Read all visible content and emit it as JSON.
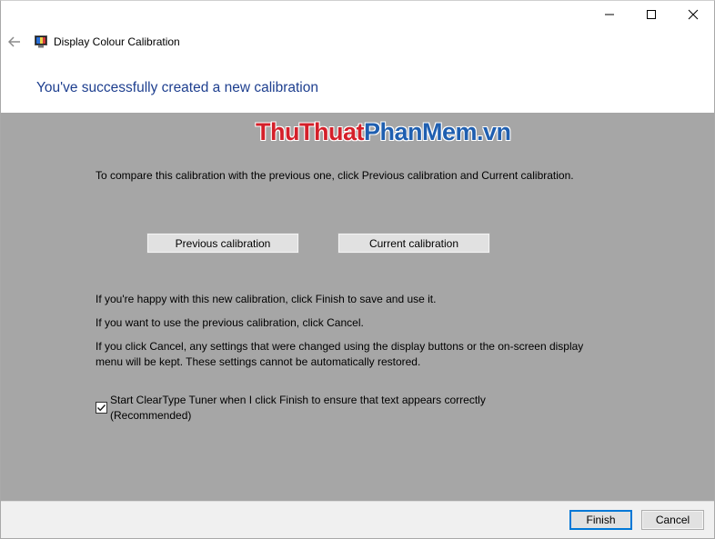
{
  "window": {
    "app_title": "Display Colour Calibration",
    "caption_buttons": {
      "minimize_icon": "minimize-icon",
      "maximize_icon": "maximize-icon",
      "close_icon": "close-icon"
    }
  },
  "header": {
    "back_icon": "back-arrow-icon",
    "app_icon": "display-calibration-icon",
    "page_title": "You've successfully created a new calibration"
  },
  "watermark": {
    "part1": "ThuThuat",
    "part2": "PhanMem",
    "part3": ".vn",
    "colors": {
      "red": "#d4202a",
      "blue": "#1f5fb0"
    }
  },
  "content": {
    "compare_text": "To compare this calibration with the previous one, click Previous calibration and Current calibration.",
    "previous_button": "Previous calibration",
    "current_button": "Current calibration",
    "finish_text": "If you're happy with this new calibration, click Finish to save and use it.",
    "cancel_text": "If you want to use the previous calibration, click Cancel.",
    "warning_text": "If you click Cancel, any settings that were changed using the display buttons or the on-screen display menu will be kept. These settings cannot be automatically restored.",
    "cleartype_checkbox": {
      "checked": true,
      "label": "Start ClearType Tuner when I click Finish to ensure that text appears correctly (Recommended)"
    },
    "background_color": "#a6a6a6"
  },
  "footer": {
    "finish_button": "Finish",
    "cancel_button": "Cancel"
  },
  "colors": {
    "title_blue": "#1e3f8f",
    "focus_blue": "#0078d7"
  }
}
